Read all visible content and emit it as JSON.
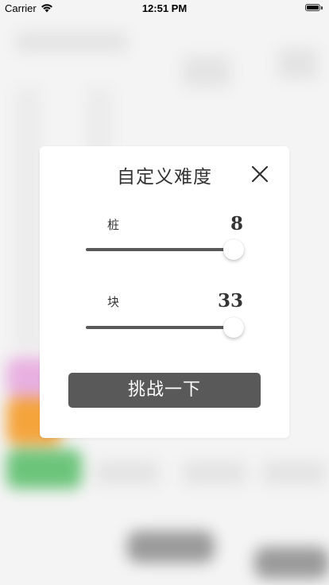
{
  "status_bar": {
    "carrier": "Carrier",
    "time": "12:51 PM"
  },
  "dialog": {
    "title": "自定义难度",
    "settings": [
      {
        "label": "桩",
        "value": "8",
        "level": 1.0
      },
      {
        "label": "块",
        "value": "33",
        "level": 1.0
      }
    ],
    "challenge_label": "挑战一下"
  },
  "colors": {
    "button": "#595959",
    "track": "#595959",
    "text": "#333333"
  }
}
